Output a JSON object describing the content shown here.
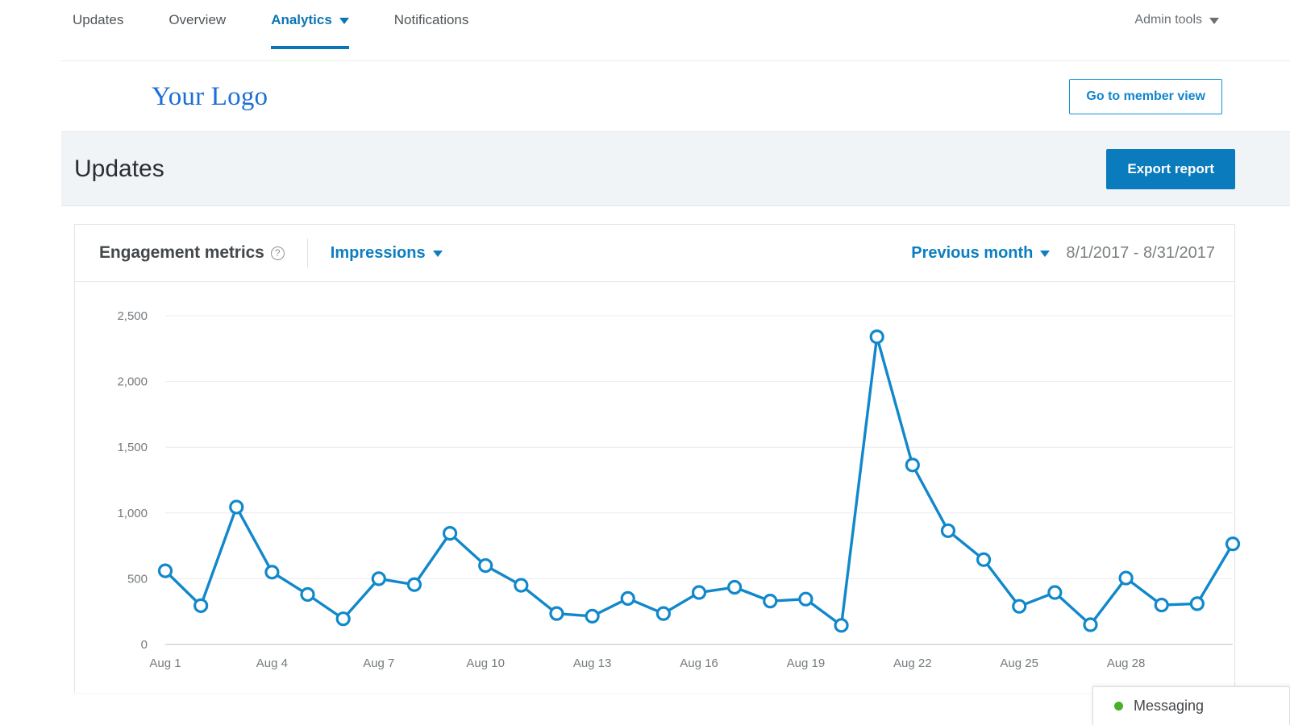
{
  "nav": {
    "items": [
      {
        "label": "Updates",
        "active": false,
        "caret": false
      },
      {
        "label": "Overview",
        "active": false,
        "caret": false
      },
      {
        "label": "Analytics",
        "active": true,
        "caret": true
      },
      {
        "label": "Notifications",
        "active": false,
        "caret": false
      }
    ],
    "admin_tools_label": "Admin tools"
  },
  "brand": {
    "logo_text": "Your Logo",
    "member_view_label": "Go to member view"
  },
  "page": {
    "title": "Updates",
    "export_label": "Export report"
  },
  "card": {
    "title": "Engagement metrics",
    "help_glyph": "?",
    "metric_label": "Impressions",
    "period_label": "Previous month",
    "date_range": "8/1/2017 - 8/31/2017"
  },
  "messaging": {
    "label": "Messaging",
    "status_color": "#4caf28"
  },
  "colors": {
    "accent_blue": "#0c7ec0",
    "line_blue": "#1188cb",
    "header_band": "#f0f4f7",
    "logo_blue": "#1b6fd6"
  },
  "chart_data": {
    "type": "line",
    "title": "Engagement metrics",
    "series_name": "Impressions",
    "xlabel": "",
    "ylabel": "",
    "ylim": [
      0,
      2500
    ],
    "yticks": [
      0,
      500,
      1000,
      1500,
      2000,
      2500
    ],
    "ytick_labels": [
      "0",
      "500",
      "1,000",
      "1,500",
      "2,000",
      "2,500"
    ],
    "grid": true,
    "legend": "none",
    "marker": "open-circle",
    "x": [
      "Aug 1",
      "Aug 2",
      "Aug 3",
      "Aug 4",
      "Aug 5",
      "Aug 6",
      "Aug 7",
      "Aug 8",
      "Aug 9",
      "Aug 10",
      "Aug 11",
      "Aug 12",
      "Aug 13",
      "Aug 14",
      "Aug 15",
      "Aug 16",
      "Aug 17",
      "Aug 18",
      "Aug 19",
      "Aug 20",
      "Aug 21",
      "Aug 22",
      "Aug 23",
      "Aug 24",
      "Aug 25",
      "Aug 26",
      "Aug 27",
      "Aug 28",
      "Aug 29",
      "Aug 30",
      "Aug 31"
    ],
    "xtick_labels": [
      "Aug 1",
      "Aug 4",
      "Aug 7",
      "Aug 10",
      "Aug 13",
      "Aug 16",
      "Aug 19",
      "Aug 22",
      "Aug 25",
      "Aug 28"
    ],
    "xtick_indices": [
      0,
      3,
      6,
      9,
      12,
      15,
      18,
      21,
      24,
      27
    ],
    "values": [
      560,
      295,
      1045,
      550,
      380,
      195,
      500,
      455,
      845,
      600,
      450,
      235,
      215,
      350,
      235,
      395,
      435,
      330,
      345,
      145,
      2340,
      1365,
      865,
      645,
      290,
      395,
      150,
      505,
      300,
      310,
      765
    ]
  }
}
